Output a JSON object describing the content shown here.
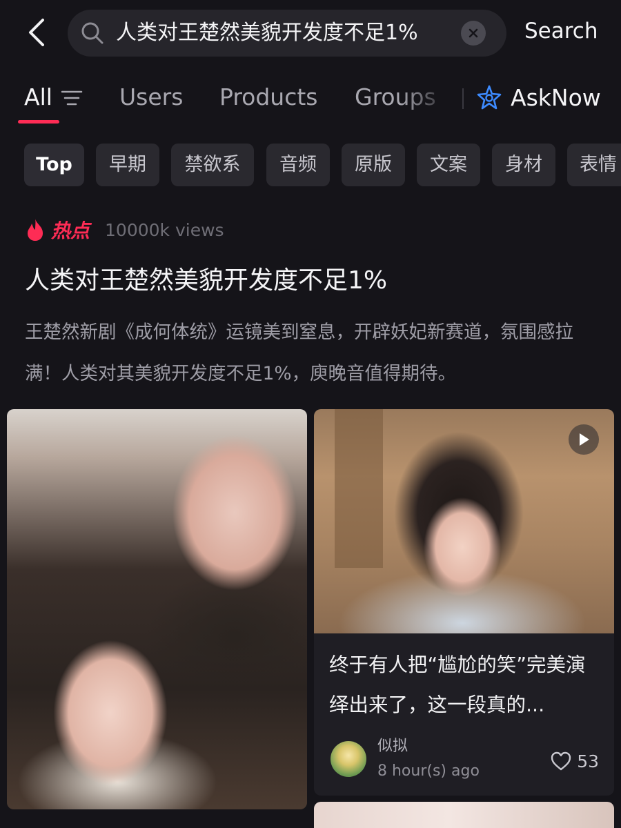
{
  "search": {
    "query": "人类对王楚然美貌开发度不足1%",
    "search_label": "Search"
  },
  "tabs": [
    {
      "label": "All",
      "active": true
    },
    {
      "label": "Users"
    },
    {
      "label": "Products"
    },
    {
      "label": "Groups"
    },
    {
      "label": "AskNow"
    }
  ],
  "chips": [
    "Top",
    "早期",
    "禁欲系",
    "音频",
    "原版",
    "文案",
    "身材",
    "表情"
  ],
  "hot": {
    "label": "热点",
    "views": "10000k views",
    "headline": "人类对王楚然美貌开发度不足1%",
    "summary": "王楚然新剧《成何体统》运镜美到窒息，开辟妖妃新赛道，氛围感拉满！人类对其美貌开发度不足1%，庾晚音值得期待。"
  },
  "cards": {
    "right": {
      "title": "终于有人把“尴尬的笑”完美演绎出来了，这一段真的...",
      "author": "似拟",
      "time": "8 hour(s) ago",
      "likes": "53"
    }
  },
  "colors": {
    "background": "#151419",
    "accent": "#fe2c55",
    "askNow": "#3d8bff"
  },
  "icons": [
    "back-arrow-icon",
    "search-icon",
    "clear-icon",
    "filter-icon",
    "asknow-star-icon",
    "flame-icon",
    "play-icon",
    "heart-icon"
  ]
}
